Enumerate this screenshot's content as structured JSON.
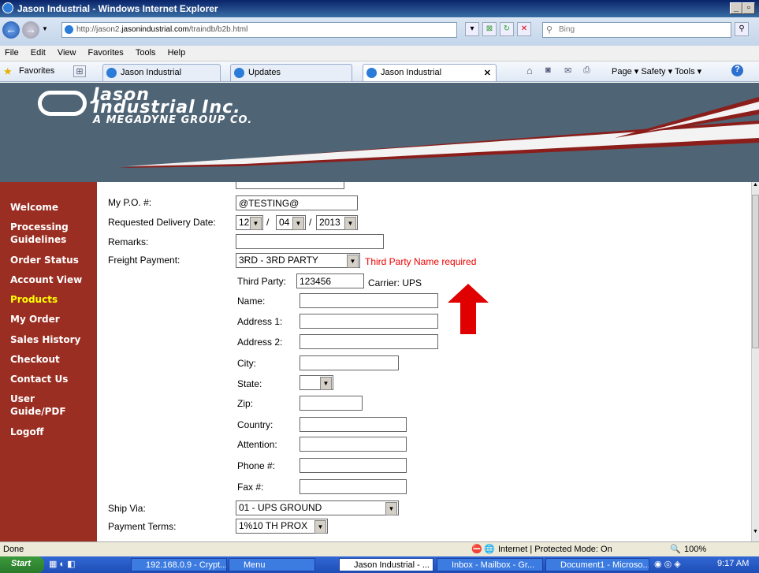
{
  "window": {
    "title": "Jason Industrial - Windows Internet Explorer"
  },
  "address": {
    "url_prefix": "http://jason2.",
    "url_domain": "jasonindustrial.com",
    "url_path": "/traindb/b2b.html",
    "search_placeholder": "Bing"
  },
  "menu": [
    "File",
    "Edit",
    "View",
    "Favorites",
    "Tools",
    "Help"
  ],
  "favbar": {
    "favorites": "Favorites",
    "tabs": [
      "Jason Industrial",
      "Updates",
      "Jason Industrial"
    ],
    "commands": "Page ▾  Safety ▾  Tools ▾"
  },
  "banner": {
    "line1": "Jason",
    "line2": "Industrial Inc.",
    "line3": "A MEGADYNE GROUP CO."
  },
  "sidebar": [
    {
      "label": "Welcome"
    },
    {
      "label": "Processing Guidelines"
    },
    {
      "label": "Order Status"
    },
    {
      "label": "Account View"
    },
    {
      "label": "Products",
      "active": true
    },
    {
      "label": "My Order"
    },
    {
      "label": "Sales History"
    },
    {
      "label": "Checkout"
    },
    {
      "label": "Contact Us"
    },
    {
      "label": "User Guide/PDF"
    },
    {
      "label": "Logoff"
    }
  ],
  "form": {
    "po_label": "My P.O. #:",
    "po_value": "@TESTING@",
    "delivery_label": "Requested Delivery Date:",
    "delivery_month": "12",
    "delivery_day": "04",
    "delivery_year": "2013",
    "sep": "/",
    "remarks_label": "Remarks:",
    "freight_label": "Freight Payment:",
    "freight_value": "3RD - 3RD PARTY",
    "freight_error": "Third Party Name required",
    "third_party_label": "Third Party:",
    "third_party_value": "123456",
    "carrier": "Carrier: UPS",
    "name_label": "Name:",
    "addr1_label": "Address 1:",
    "addr2_label": "Address 2:",
    "city_label": "City:",
    "state_label": "State:",
    "zip_label": "Zip:",
    "country_label": "Country:",
    "attention_label": "Attention:",
    "phone_label": "Phone #:",
    "fax_label": "Fax #:",
    "shipvia_label": "Ship Via:",
    "shipvia_value": "01 - UPS GROUND",
    "terms_label": "Payment Terms:",
    "terms_value": "1%10 TH PROX"
  },
  "status": {
    "left": "Done",
    "zone": "Internet | Protected Mode: On",
    "zoom": "100%"
  },
  "taskbar": {
    "start": "Start",
    "tasks": [
      "192.168.0.9 - Crypt...",
      "Menu",
      "Jason Industrial - ...",
      "Inbox - Mailbox - Gr...",
      "Document1 - Microso..."
    ],
    "clock": "9:17 AM"
  },
  "colors": {
    "sidebar": "#9b2e22",
    "banner": "#4f6475",
    "error": "#e00000",
    "arrow": "#e00000"
  }
}
